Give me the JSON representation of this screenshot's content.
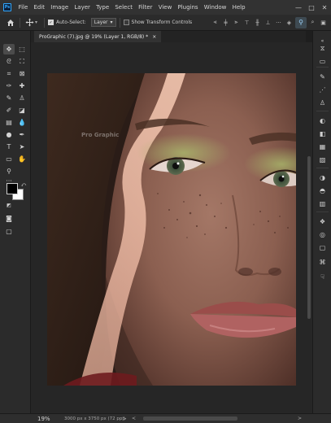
{
  "app": {
    "logo_text": "Ps"
  },
  "menu": {
    "items": [
      "File",
      "Edit",
      "Image",
      "Layer",
      "Type",
      "Select",
      "Filter",
      "View",
      "Plugins",
      "Window",
      "Help"
    ]
  },
  "window_controls": {
    "minimize": "—",
    "maximize": "□",
    "close": "✕"
  },
  "options_bar": {
    "auto_select_label": "Auto-Select:",
    "auto_select_checked": true,
    "target_value": "Layer",
    "show_transform_label": "Show Transform Controls",
    "show_transform_checked": false,
    "more": "···"
  },
  "document": {
    "tab_title": "ProGraphic (7).jpg @ 19% (Layer 1, RGB/8) *",
    "close_glyph": "×",
    "watermark": "Pro Graphic"
  },
  "status": {
    "zoom": "19%",
    "doc_info": "3000 px x 3750 px (72 ppi)",
    "arrow": ">",
    "scroll_left": "<",
    "scroll_right": ">"
  },
  "colors": {
    "accent": "#31a8ff",
    "panel": "#2b2b2b",
    "chrome": "#323232",
    "canvas_bg": "#262626"
  }
}
